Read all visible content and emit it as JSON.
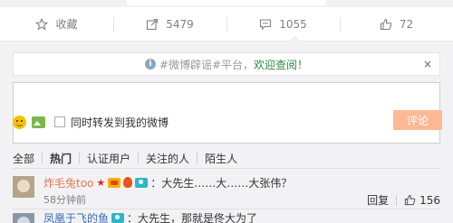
{
  "actions": {
    "favorite": "收藏",
    "share_count": "5479",
    "comment_count": "1055",
    "like_count": "72"
  },
  "notice": {
    "prefix": "#微博辟谣#平台，",
    "highlight": "欢迎查阅！",
    "close": "×"
  },
  "composer": {
    "input_value": "",
    "repost_label": "同时转发到我的微博",
    "submit_label": "评论"
  },
  "filters": {
    "tabs": [
      "全部",
      "热门",
      "认证用户",
      "关注的人",
      "陌生人"
    ]
  },
  "comments": [
    {
      "user": "炸毛兔too",
      "text": "：大先生……大……大张伟？",
      "time": "58分钟前",
      "reply_label": "回复",
      "like_count": "156"
    },
    {
      "user": "凤凰于飞的鱼",
      "text": "：大先生，那就是佟大为了"
    }
  ],
  "colors": {
    "accent_orange": "#eb7350",
    "submit_bg": "#fdb996",
    "panel_bg": "#f2f2f5",
    "notice_highlight": "#2e8b3f"
  }
}
